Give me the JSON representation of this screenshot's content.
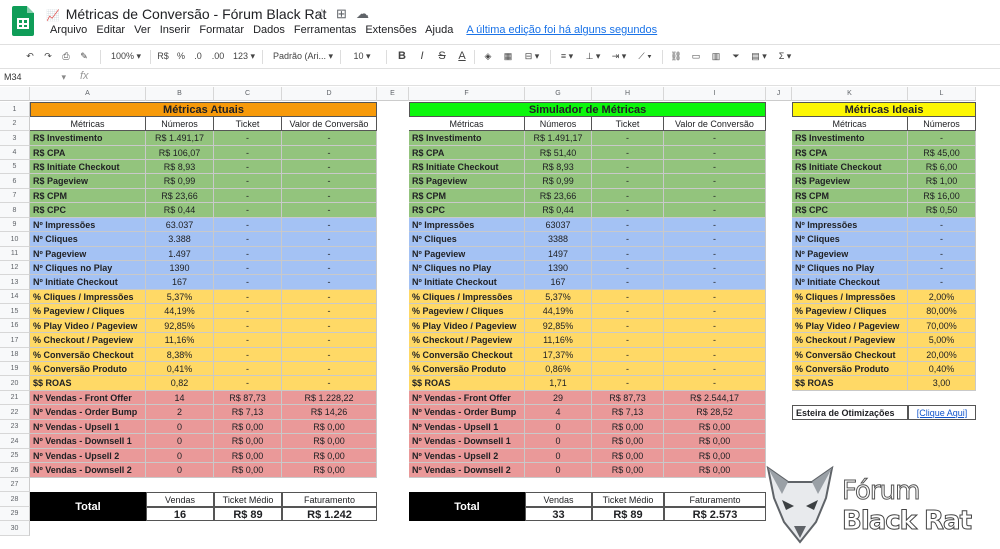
{
  "titlebar": {
    "title": "Métricas de Conversão - Fórum Black Rat",
    "title_emoji": "📈"
  },
  "menu": {
    "items": [
      "Arquivo",
      "Editar",
      "Ver",
      "Inserir",
      "Formatar",
      "Dados",
      "Ferramentas",
      "Extensões",
      "Ajuda"
    ],
    "last_edit": "A última edição foi há alguns segundos"
  },
  "toolbar": {
    "zoom": "100%",
    "currency": "R$",
    "percent": "%",
    "dec_less": ".0",
    "dec_more": ".00",
    "format": "123",
    "font": "Padrão (Ari...",
    "font_size": "10"
  },
  "formula": {
    "cell": "M34",
    "fx": "fx",
    "value": ""
  },
  "colors": {
    "orange": "#f79a0a",
    "green": "#0cf70c",
    "yellow": "#fdf703",
    "money": "#93c47d",
    "count": "#a4c2f4",
    "rate": "#ffd966",
    "sales": "#ea9999",
    "link": "#1155cc"
  },
  "grid": {
    "columns": [
      "A",
      "B",
      "C",
      "D",
      "E",
      "F",
      "G",
      "H",
      "I",
      "J",
      "K",
      "L"
    ],
    "rows": [
      "1",
      "2",
      "3",
      "4",
      "5",
      "6",
      "7",
      "8",
      "9",
      "10",
      "11",
      "12",
      "13",
      "14",
      "15",
      "16",
      "17",
      "18",
      "19",
      "20",
      "21",
      "22",
      "23",
      "24",
      "25",
      "26",
      "27",
      "28",
      "29",
      "30"
    ],
    "table1": {
      "title": "Métricas Atuais",
      "headers": [
        "Métricas",
        "Números",
        "Ticket",
        "Valor de Conversão"
      ],
      "rows": [
        [
          "R$ Investimento",
          "R$ 1.491,17",
          "-",
          "-"
        ],
        [
          "R$ CPA",
          "R$ 106,07",
          "-",
          "-"
        ],
        [
          "R$ Initiate Checkout",
          "R$ 8,93",
          "-",
          "-"
        ],
        [
          "R$ Pageview",
          "R$ 0,99",
          "-",
          "-"
        ],
        [
          "R$ CPM",
          "R$ 23,66",
          "-",
          "-"
        ],
        [
          "R$ CPC",
          "R$ 0,44",
          "-",
          "-"
        ],
        [
          "Nº Impressões",
          "63.037",
          "-",
          "-"
        ],
        [
          "Nº Cliques",
          "3.388",
          "-",
          "-"
        ],
        [
          "Nº Pageview",
          "1.497",
          "-",
          "-"
        ],
        [
          "Nº Cliques no Play",
          "1390",
          "-",
          "-"
        ],
        [
          "Nº Initiate Checkout",
          "167",
          "-",
          "-"
        ],
        [
          "% Cliques / Impressões",
          "5,37%",
          "-",
          "-"
        ],
        [
          "% Pageview / Cliques",
          "44,19%",
          "-",
          "-"
        ],
        [
          "% Play Video / Pageview",
          "92,85%",
          "-",
          "-"
        ],
        [
          "% Checkout / Pageview",
          "11,16%",
          "-",
          "-"
        ],
        [
          "% Conversão Checkout",
          "8,38%",
          "-",
          "-"
        ],
        [
          "% Conversão Produto",
          "0,41%",
          "-",
          "-"
        ],
        [
          "$$ ROAS",
          "0,82",
          "-",
          "-"
        ],
        [
          "Nº Vendas - Front Offer",
          "14",
          "R$ 87,73",
          "R$ 1.228,22"
        ],
        [
          "Nº Vendas - Order Bump",
          "2",
          "R$ 7,13",
          "R$ 14,26"
        ],
        [
          "Nº Vendas - Upsell 1",
          "0",
          "R$ 0,00",
          "R$ 0,00"
        ],
        [
          "Nº Vendas - Downsell 1",
          "0",
          "R$ 0,00",
          "R$ 0,00"
        ],
        [
          "Nº Vendas - Upsell 2",
          "0",
          "R$ 0,00",
          "R$ 0,00"
        ],
        [
          "Nº Vendas - Downsell 2",
          "0",
          "R$ 0,00",
          "R$ 0,00"
        ]
      ],
      "total_label": "Total",
      "total_headers": [
        "Vendas",
        "Ticket Médio",
        "Faturamento"
      ],
      "total_values": [
        "16",
        "R$ 89",
        "R$ 1.242"
      ]
    },
    "table2": {
      "title": "Simulador de Métricas",
      "headers": [
        "Métricas",
        "Números",
        "Ticket",
        "Valor de Conversão"
      ],
      "rows": [
        [
          "R$ Investimento",
          "R$ 1.491,17",
          "-",
          "-"
        ],
        [
          "R$ CPA",
          "R$ 51,40",
          "-",
          "-"
        ],
        [
          "R$ Initiate Checkout",
          "R$ 8,93",
          "-",
          "-"
        ],
        [
          "R$ Pageview",
          "R$ 0,99",
          "-",
          "-"
        ],
        [
          "R$ CPM",
          "R$ 23,66",
          "-",
          "-"
        ],
        [
          "R$ CPC",
          "R$ 0,44",
          "-",
          "-"
        ],
        [
          "Nº Impressões",
          "63037",
          "-",
          "-"
        ],
        [
          "Nº Cliques",
          "3388",
          "-",
          "-"
        ],
        [
          "Nº Pageview",
          "1497",
          "-",
          "-"
        ],
        [
          "Nº Cliques no Play",
          "1390",
          "-",
          "-"
        ],
        [
          "Nº Initiate Checkout",
          "167",
          "-",
          "-"
        ],
        [
          "% Cliques / Impressões",
          "5,37%",
          "-",
          "-"
        ],
        [
          "% Pageview / Cliques",
          "44,19%",
          "-",
          "-"
        ],
        [
          "% Play Video / Pageview",
          "92,85%",
          "-",
          "-"
        ],
        [
          "% Checkout / Pageview",
          "11,16%",
          "-",
          "-"
        ],
        [
          "% Conversão Checkout",
          "17,37%",
          "-",
          "-"
        ],
        [
          "% Conversão Produto",
          "0,86%",
          "-",
          "-"
        ],
        [
          "$$ ROAS",
          "1,71",
          "-",
          "-"
        ],
        [
          "Nº Vendas - Front Offer",
          "29",
          "R$ 87,73",
          "R$ 2.544,17"
        ],
        [
          "Nº Vendas - Order Bump",
          "4",
          "R$ 7,13",
          "R$ 28,52"
        ],
        [
          "Nº Vendas - Upsell 1",
          "0",
          "R$ 0,00",
          "R$ 0,00"
        ],
        [
          "Nº Vendas - Downsell 1",
          "0",
          "R$ 0,00",
          "R$ 0,00"
        ],
        [
          "Nº Vendas - Upsell 2",
          "0",
          "R$ 0,00",
          "R$ 0,00"
        ],
        [
          "Nº Vendas - Downsell 2",
          "0",
          "R$ 0,00",
          "R$ 0,00"
        ]
      ],
      "total_label": "Total",
      "total_headers": [
        "Vendas",
        "Ticket Médio",
        "Faturamento"
      ],
      "total_values": [
        "33",
        "R$ 89",
        "R$ 2.573"
      ]
    },
    "table3": {
      "title": "Métricas Ideais",
      "headers": [
        "Métricas",
        "Números"
      ],
      "rows": [
        [
          "R$ Investimento",
          "-"
        ],
        [
          "R$ CPA",
          "R$ 45,00"
        ],
        [
          "R$ Initiate Checkout",
          "R$ 6,00"
        ],
        [
          "R$ Pageview",
          "R$ 1,00"
        ],
        [
          "R$ CPM",
          "R$ 16,00"
        ],
        [
          "R$ CPC",
          "R$ 0,50"
        ],
        [
          "Nº Impressões",
          "-"
        ],
        [
          "Nº Cliques",
          "-"
        ],
        [
          "Nº Pageview",
          "-"
        ],
        [
          "Nº Cliques no Play",
          "-"
        ],
        [
          "Nº Initiate Checkout",
          "-"
        ],
        [
          "% Cliques / Impressões",
          "2,00%"
        ],
        [
          "% Pageview / Cliques",
          "80,00%"
        ],
        [
          "% Play Video / Pageview",
          "70,00%"
        ],
        [
          "% Checkout / Pageview",
          "5,00%"
        ],
        [
          "% Conversão Checkout",
          "20,00%"
        ],
        [
          "% Conversão Produto",
          "0,40%"
        ],
        [
          "$$ ROAS",
          "3,00"
        ]
      ],
      "opt_label": "Esteira de Otimizações",
      "opt_link": "[Clique Aqui]"
    }
  },
  "watermark": {
    "line1": "Fórum",
    "line2": "Black Rat"
  }
}
